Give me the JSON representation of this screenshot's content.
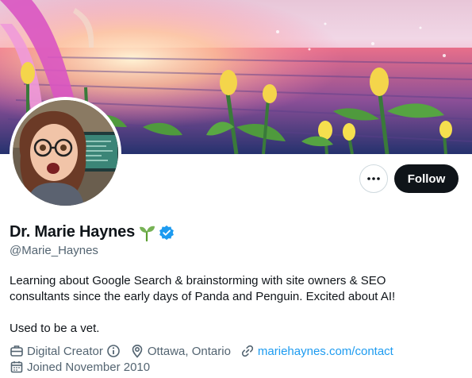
{
  "profile": {
    "name": "Dr. Marie Haynes",
    "handle": "@Marie_Haynes",
    "bio_lines": [
      "Learning about Google Search & brainstorming with site owners & SEO",
      "consultants since the early days of Panda and Penguin. Excited about AI!"
    ],
    "bio_extra": "Used to be a vet.",
    "category": "Digital Creator",
    "location": "Ottawa, Ontario",
    "website": "mariehaynes.com/contact",
    "joined": "Joined November 2010"
  },
  "actions": {
    "follow_label": "Follow"
  },
  "icons": {
    "more": "more-icon",
    "verified": "verified-badge-icon",
    "seedling": "seedling-emoji-icon",
    "briefcase": "briefcase-icon",
    "info": "info-icon",
    "location": "location-pin-icon",
    "link": "link-icon",
    "calendar": "calendar-icon"
  },
  "colors": {
    "accent": "#1d9bf0",
    "text": "#0f1419",
    "secondary": "#536471",
    "follow_bg": "#0f1419"
  }
}
